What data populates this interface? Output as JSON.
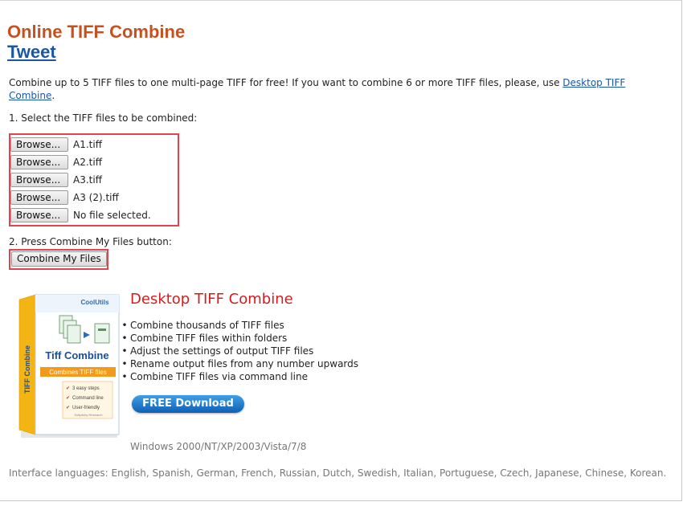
{
  "header": {
    "title": "Online TIFF Combine",
    "tweet_label": "Tweet"
  },
  "intro": {
    "text": "Combine up to 5 TIFF files to one multi-page TIFF for free! If you want to combine 6 or more TIFF files, please, use ",
    "link_label": "Desktop TIFF Combine",
    "trailing": "."
  },
  "step1": {
    "label": "1. Select the TIFF files to be combined:",
    "browse_label": "Browse...",
    "files": [
      "A1.tiff",
      "A2.tiff",
      "A3.tiff",
      "A3 (2).tiff",
      "No file selected."
    ]
  },
  "step2": {
    "label": "2. Press Combine My Files button:",
    "button_label": "Combine My Files"
  },
  "promo": {
    "title": "Desktop TIFF Combine",
    "features": [
      "Combine thousands of TIFF files",
      "Combine TIFF files within folders",
      "Adjust the settings of output TIFF files",
      "Rename output files from any number upwards",
      "Combine TIFF files via command line"
    ],
    "download_label": "FREE Download",
    "os_text": "Windows 2000/NT/XP/2003/Vista/7/8",
    "box": {
      "brand": "CoolUtils",
      "product_name": "Tiff Combine",
      "tagline": "Combines TIFF files",
      "side_text": "TIFF Combine",
      "checklist": [
        "3 easy steps",
        "Command line",
        "User-friendly"
      ],
      "footer": "Softplicity Research"
    }
  },
  "footer": {
    "languages": "Interface languages: English, Spanish, German, French, Russian, Dutch, Swedish, Italian, Portuguese, Czech, Japanese, Chinese, Korean."
  },
  "colors": {
    "title": "#c8501e",
    "link": "#1a56a8",
    "highlight_border": "#e0454f",
    "promo_title": "#d41c1c",
    "download_button": "#1f78cc"
  }
}
